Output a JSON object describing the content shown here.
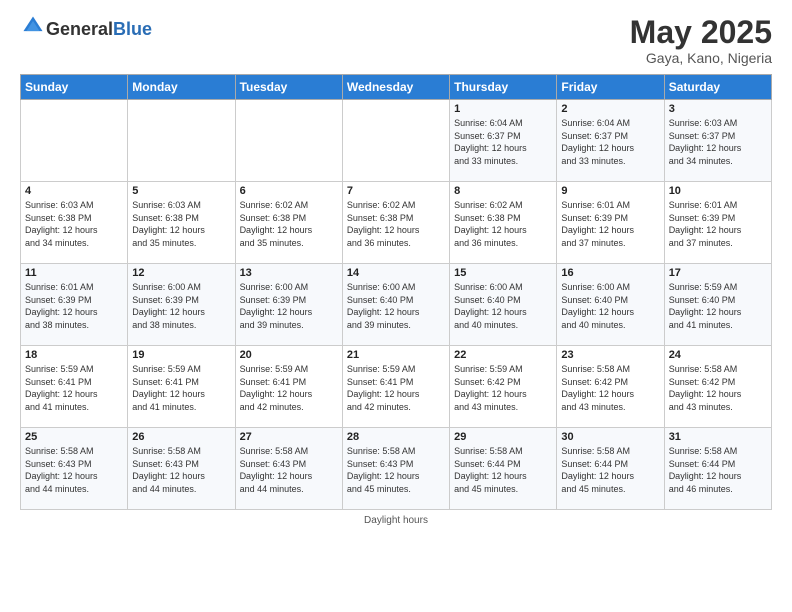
{
  "header": {
    "logo_general": "General",
    "logo_blue": "Blue",
    "month_title": "May 2025",
    "location": "Gaya, Kano, Nigeria"
  },
  "days_of_week": [
    "Sunday",
    "Monday",
    "Tuesday",
    "Wednesday",
    "Thursday",
    "Friday",
    "Saturday"
  ],
  "weeks": [
    [
      {
        "day": "",
        "info": ""
      },
      {
        "day": "",
        "info": ""
      },
      {
        "day": "",
        "info": ""
      },
      {
        "day": "",
        "info": ""
      },
      {
        "day": "1",
        "info": "Sunrise: 6:04 AM\nSunset: 6:37 PM\nDaylight: 12 hours\nand 33 minutes."
      },
      {
        "day": "2",
        "info": "Sunrise: 6:04 AM\nSunset: 6:37 PM\nDaylight: 12 hours\nand 33 minutes."
      },
      {
        "day": "3",
        "info": "Sunrise: 6:03 AM\nSunset: 6:37 PM\nDaylight: 12 hours\nand 34 minutes."
      }
    ],
    [
      {
        "day": "4",
        "info": "Sunrise: 6:03 AM\nSunset: 6:38 PM\nDaylight: 12 hours\nand 34 minutes."
      },
      {
        "day": "5",
        "info": "Sunrise: 6:03 AM\nSunset: 6:38 PM\nDaylight: 12 hours\nand 35 minutes."
      },
      {
        "day": "6",
        "info": "Sunrise: 6:02 AM\nSunset: 6:38 PM\nDaylight: 12 hours\nand 35 minutes."
      },
      {
        "day": "7",
        "info": "Sunrise: 6:02 AM\nSunset: 6:38 PM\nDaylight: 12 hours\nand 36 minutes."
      },
      {
        "day": "8",
        "info": "Sunrise: 6:02 AM\nSunset: 6:38 PM\nDaylight: 12 hours\nand 36 minutes."
      },
      {
        "day": "9",
        "info": "Sunrise: 6:01 AM\nSunset: 6:39 PM\nDaylight: 12 hours\nand 37 minutes."
      },
      {
        "day": "10",
        "info": "Sunrise: 6:01 AM\nSunset: 6:39 PM\nDaylight: 12 hours\nand 37 minutes."
      }
    ],
    [
      {
        "day": "11",
        "info": "Sunrise: 6:01 AM\nSunset: 6:39 PM\nDaylight: 12 hours\nand 38 minutes."
      },
      {
        "day": "12",
        "info": "Sunrise: 6:00 AM\nSunset: 6:39 PM\nDaylight: 12 hours\nand 38 minutes."
      },
      {
        "day": "13",
        "info": "Sunrise: 6:00 AM\nSunset: 6:39 PM\nDaylight: 12 hours\nand 39 minutes."
      },
      {
        "day": "14",
        "info": "Sunrise: 6:00 AM\nSunset: 6:40 PM\nDaylight: 12 hours\nand 39 minutes."
      },
      {
        "day": "15",
        "info": "Sunrise: 6:00 AM\nSunset: 6:40 PM\nDaylight: 12 hours\nand 40 minutes."
      },
      {
        "day": "16",
        "info": "Sunrise: 6:00 AM\nSunset: 6:40 PM\nDaylight: 12 hours\nand 40 minutes."
      },
      {
        "day": "17",
        "info": "Sunrise: 5:59 AM\nSunset: 6:40 PM\nDaylight: 12 hours\nand 41 minutes."
      }
    ],
    [
      {
        "day": "18",
        "info": "Sunrise: 5:59 AM\nSunset: 6:41 PM\nDaylight: 12 hours\nand 41 minutes."
      },
      {
        "day": "19",
        "info": "Sunrise: 5:59 AM\nSunset: 6:41 PM\nDaylight: 12 hours\nand 41 minutes."
      },
      {
        "day": "20",
        "info": "Sunrise: 5:59 AM\nSunset: 6:41 PM\nDaylight: 12 hours\nand 42 minutes."
      },
      {
        "day": "21",
        "info": "Sunrise: 5:59 AM\nSunset: 6:41 PM\nDaylight: 12 hours\nand 42 minutes."
      },
      {
        "day": "22",
        "info": "Sunrise: 5:59 AM\nSunset: 6:42 PM\nDaylight: 12 hours\nand 43 minutes."
      },
      {
        "day": "23",
        "info": "Sunrise: 5:58 AM\nSunset: 6:42 PM\nDaylight: 12 hours\nand 43 minutes."
      },
      {
        "day": "24",
        "info": "Sunrise: 5:58 AM\nSunset: 6:42 PM\nDaylight: 12 hours\nand 43 minutes."
      }
    ],
    [
      {
        "day": "25",
        "info": "Sunrise: 5:58 AM\nSunset: 6:43 PM\nDaylight: 12 hours\nand 44 minutes."
      },
      {
        "day": "26",
        "info": "Sunrise: 5:58 AM\nSunset: 6:43 PM\nDaylight: 12 hours\nand 44 minutes."
      },
      {
        "day": "27",
        "info": "Sunrise: 5:58 AM\nSunset: 6:43 PM\nDaylight: 12 hours\nand 44 minutes."
      },
      {
        "day": "28",
        "info": "Sunrise: 5:58 AM\nSunset: 6:43 PM\nDaylight: 12 hours\nand 45 minutes."
      },
      {
        "day": "29",
        "info": "Sunrise: 5:58 AM\nSunset: 6:44 PM\nDaylight: 12 hours\nand 45 minutes."
      },
      {
        "day": "30",
        "info": "Sunrise: 5:58 AM\nSunset: 6:44 PM\nDaylight: 12 hours\nand 45 minutes."
      },
      {
        "day": "31",
        "info": "Sunrise: 5:58 AM\nSunset: 6:44 PM\nDaylight: 12 hours\nand 46 minutes."
      }
    ]
  ],
  "footer": {
    "daylight_label": "Daylight hours"
  }
}
